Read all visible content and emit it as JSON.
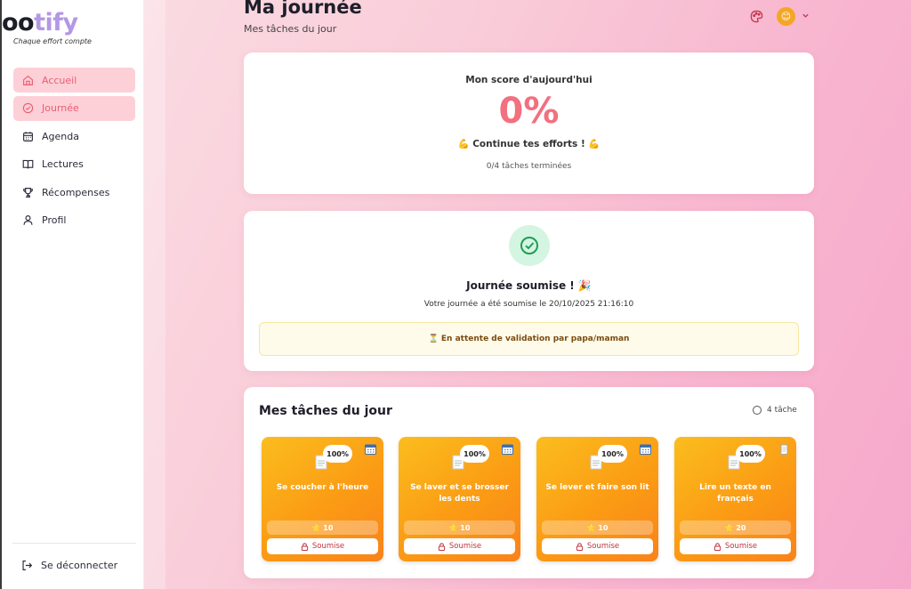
{
  "app": {
    "logo_dark": "oo",
    "logo_accent": "tify",
    "tagline": "Chaque effort compte"
  },
  "sidebar": {
    "items": [
      {
        "label": "Accueil",
        "icon": "home-icon",
        "active": true
      },
      {
        "label": "Journée",
        "icon": "check-circle-icon",
        "active": true
      },
      {
        "label": "Agenda",
        "icon": "calendar-icon",
        "active": false
      },
      {
        "label": "Lectures",
        "icon": "book-icon",
        "active": false
      },
      {
        "label": "Récompenses",
        "icon": "trophy-icon",
        "active": false
      },
      {
        "label": "Profil",
        "icon": "user-icon",
        "active": false
      }
    ],
    "logout_label": "Se déconnecter"
  },
  "header": {
    "title": "Ma journée",
    "subtitle": "Mes tâches du jour",
    "avatar_emoji": "😊"
  },
  "score": {
    "label": "Mon score d'aujourd'hui",
    "value": "0%",
    "encouragement": "💪 Continue tes efforts ! 💪",
    "done_count": "0/4 tâches terminées"
  },
  "submission": {
    "title": "Journée soumise ! 🎉",
    "text": "Votre journée a été soumise le 20/10/2025 21:16:10",
    "waiting": "⏳ En attente de validation par papa/maman"
  },
  "tasks": {
    "title": "Mes tâches du jour",
    "count": "4 tâche",
    "items": [
      {
        "name": "Se coucher à l'heure",
        "percent": "100%",
        "points": "⭐ 10",
        "status": "Soumise",
        "type_icon": "calendar-icon"
      },
      {
        "name": "Se laver et se brosser les dents",
        "percent": "100%",
        "points": "⭐ 10",
        "status": "Soumise",
        "type_icon": "calendar-icon"
      },
      {
        "name": "Se lever et faire son lit",
        "percent": "100%",
        "points": "⭐ 10",
        "status": "Soumise",
        "type_icon": "calendar-icon"
      },
      {
        "name": "Lire un texte en français",
        "percent": "100%",
        "points": "⭐ 20",
        "status": "Soumise",
        "type_icon": "scroll-icon"
      }
    ]
  },
  "colors": {
    "accent": "#f2707f",
    "active_nav_bg": "#fdd0d7",
    "task_orange": "#fb9b14",
    "logo_purple": "#b497e6",
    "success_bg": "#d4f5e1"
  }
}
